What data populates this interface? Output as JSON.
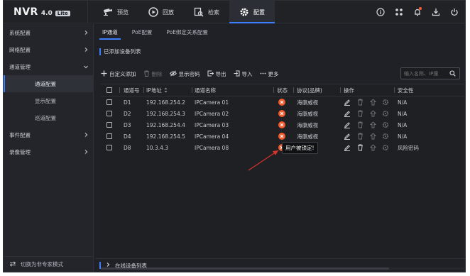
{
  "app": {
    "logo": "NVR",
    "version": "4.0",
    "edition": "Lite"
  },
  "nav": [
    {
      "label": "预览",
      "icon": "camera-icon"
    },
    {
      "label": "回放",
      "icon": "playback-icon"
    },
    {
      "label": "检索",
      "icon": "search-file-icon"
    },
    {
      "label": "配置",
      "icon": "gear-icon",
      "active": true
    }
  ],
  "top_icons": [
    "info-icon",
    "network-icon",
    "bell-icon",
    "download-icon",
    "power-icon"
  ],
  "sidebar": {
    "items": [
      {
        "label": "系统配置",
        "expanded": false
      },
      {
        "label": "网络配置",
        "expanded": false
      },
      {
        "label": "通道管理",
        "expanded": true
      },
      {
        "label": "事件配置",
        "expanded": false
      },
      {
        "label": "录像管理",
        "expanded": false
      }
    ],
    "sub_items": [
      {
        "label": "通道配置",
        "active": true
      },
      {
        "label": "显示配置"
      },
      {
        "label": "巡道配置"
      }
    ],
    "footer": "切换为非专家模式"
  },
  "tabs": [
    {
      "label": "IP通道",
      "active": true
    },
    {
      "label": "PoE配置"
    },
    {
      "label": "PoE绑定关系配置"
    }
  ],
  "section_title": "已添加设备列表",
  "toolbar": {
    "add": "自定义添加",
    "delete": "删除",
    "show_password": "显示密码",
    "export": "导出",
    "import": "导入",
    "more": "更多"
  },
  "search": {
    "placeholder": "输入名称、IP搜"
  },
  "table": {
    "headers": {
      "channel": "通道号",
      "ip": "IP地址",
      "name": "通道名称",
      "status": "状态",
      "protocol": "协议(品牌)",
      "ops": "操作",
      "security": "安全性"
    },
    "rows": [
      {
        "channel": "D1",
        "ip": "192.168.254.2",
        "name": "IPCamera 01",
        "protocol": "海康威视",
        "security": "N/A"
      },
      {
        "channel": "D2",
        "ip": "192.168.254.3",
        "name": "IPCamera 02",
        "protocol": "海康威视",
        "security": "N/A"
      },
      {
        "channel": "D3",
        "ip": "192.168.254.4",
        "name": "IPCamera 03",
        "protocol": "海康威视",
        "security": "N/A"
      },
      {
        "channel": "D4",
        "ip": "192.168.254.5",
        "name": "IPCamera 04",
        "protocol": "海康威视",
        "security": "N/A"
      },
      {
        "channel": "D8",
        "ip": "10.3.4.3",
        "name": "IPCamera 08",
        "protocol": "视",
        "security": "风险密码"
      }
    ]
  },
  "tooltip": "用户被锁定!",
  "bottom_section": "在线设备列表",
  "colors": {
    "accent": "#3d7eff",
    "status_error": "#f25a2a",
    "annotation_arrow": "#d9342b"
  }
}
